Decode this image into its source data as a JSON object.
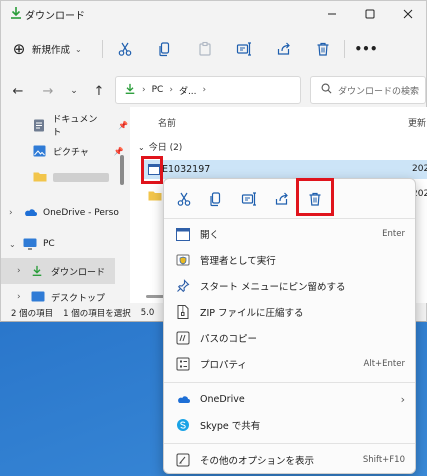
{
  "window": {
    "title": "ダウンロード"
  },
  "toolbar": {
    "new_label": "新規作成",
    "more_label": "•••"
  },
  "address": {
    "path_pc": "PC",
    "path_cut": "ダ...",
    "search_placeholder": "ダウンロードの検索"
  },
  "sidebar": {
    "items": [
      {
        "label": "ドキュメント"
      },
      {
        "label": "ピクチャ"
      },
      {
        "label": "OneDrive - Perso"
      },
      {
        "label": "PC"
      },
      {
        "label": "ダウンロード"
      },
      {
        "label": "デスクトップ"
      }
    ]
  },
  "content": {
    "col_name": "名前",
    "col_date": "更新",
    "group": "今日 (2)",
    "file_name": "E1032197",
    "date_cut_1": "202",
    "date_cut_2": "202"
  },
  "status": {
    "count": "2 個の項目",
    "selected": "1 個の項目を選択",
    "size": "5.0"
  },
  "context_menu": {
    "items": [
      {
        "label": "開く",
        "shortcut": "Enter"
      },
      {
        "label": "管理者として実行",
        "shortcut": ""
      },
      {
        "label": "スタート メニューにピン留めする",
        "shortcut": ""
      },
      {
        "label": "ZIP ファイルに圧縮する",
        "shortcut": ""
      },
      {
        "label": "パスのコピー",
        "shortcut": ""
      },
      {
        "label": "プロパティ",
        "shortcut": "Alt+Enter"
      },
      {
        "label": "OneDrive",
        "shortcut": ""
      },
      {
        "label": "Skype で共有",
        "shortcut": ""
      },
      {
        "label": "その他のオプションを表示",
        "shortcut": "Shift+F10"
      }
    ]
  },
  "colors": {
    "accent": "#1f5fae",
    "selection": "#cce4f7",
    "highlight_box": "#e0141c"
  }
}
